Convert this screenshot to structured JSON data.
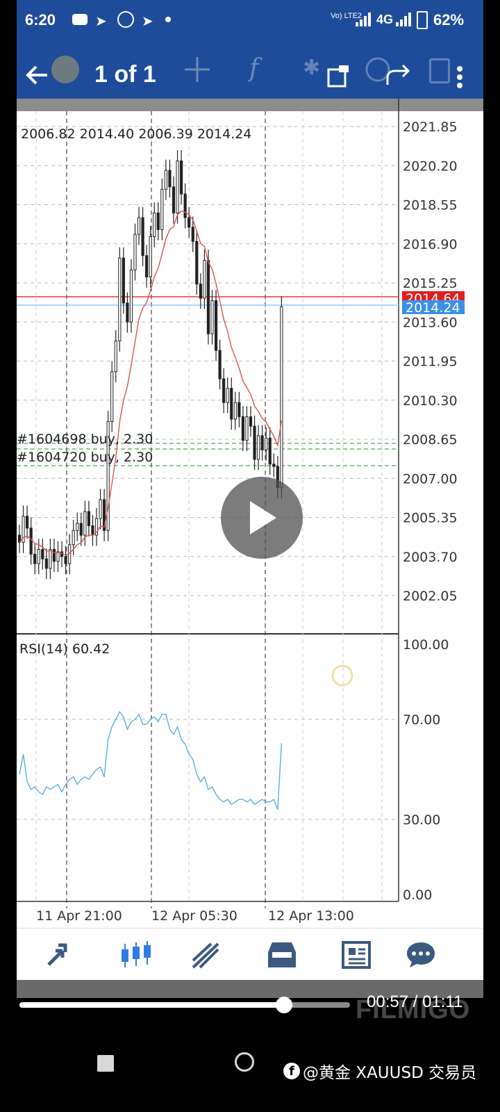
{
  "status_bar": {
    "time": "6:20",
    "network": "4G",
    "volte": "Vo) LTE2",
    "battery": "62%"
  },
  "toolbar": {
    "back_icon": "arrow-left-icon",
    "title": "1 of 1",
    "icons": [
      "crosshair-icon",
      "function-icon",
      "share-icon",
      "redo-icon",
      "more-vert-icon"
    ]
  },
  "chart": {
    "ohlc_text": "2006.82 2014.40 2006.39 2014.24",
    "price_levels": [
      "2021.85",
      "2020.20",
      "2018.55",
      "2016.90",
      "2015.25",
      "2013.60",
      "2011.95",
      "2010.30",
      "2008.65",
      "2007.00",
      "2005.35",
      "2003.70",
      "2002.05"
    ],
    "ask_price": "2014.64",
    "bid_price": "2014.24",
    "orders": [
      {
        "label": "#1604698 buy, 2.30"
      },
      {
        "label": "#1604720 buy, 2.30"
      }
    ],
    "rsi_label": "RSI(14) 60.42",
    "rsi_levels": [
      "100.00",
      "70.00",
      "30.00",
      "0.00"
    ],
    "time_labels": [
      "11 Apr 21:00",
      "12 Apr 05:30",
      "12 Apr 13:00"
    ],
    "colors": {
      "up": "#222222",
      "ma": "#d9534f",
      "ask_line": "#e53935",
      "bid_line": "#90caf9",
      "rsi": "#5aaee0",
      "ask_bg": "#e02020",
      "bid_bg": "#3b8fe8"
    }
  },
  "chart_data": {
    "type": "candlestick",
    "instrument": "XAUUSD",
    "ylim": [
      2001.0,
      2022.5
    ],
    "closes": [
      2004.3,
      2005.4,
      2004.9,
      2003.8,
      2003.4,
      2004.0,
      2003.6,
      2003.2,
      2004.0,
      2003.5,
      2003.9,
      2003.7,
      2003.4,
      2004.2,
      2004.8,
      2005.1,
      2004.6,
      2005.6,
      2005.0,
      2004.6,
      2005.3,
      2006.1,
      2004.8,
      2009.4,
      2011.5,
      2012.8,
      2016.3,
      2014.4,
      2013.6,
      2015.8,
      2017.3,
      2018.0,
      2016.4,
      2015.5,
      2017.2,
      2018.2,
      2017.5,
      2019.2,
      2020.0,
      2019.3,
      2018.2,
      2020.4,
      2019.0,
      2018.0,
      2017.6,
      2017.0,
      2015.2,
      2014.6,
      2016.2,
      2013.1,
      2014.5,
      2012.4,
      2011.2,
      2010.2,
      2010.8,
      2009.5,
      2010.2,
      2009.6,
      2008.6,
      2009.6,
      2009.2,
      2007.8,
      2008.8,
      2008.2,
      2008.7,
      2007.6,
      2007.5,
      2006.6,
      2014.24
    ],
    "rsi_values": [
      48,
      56,
      45,
      42,
      43,
      41,
      40,
      43,
      42,
      43,
      44,
      41,
      44,
      46,
      47,
      44,
      46,
      47,
      46,
      48,
      50,
      51,
      47,
      62,
      67,
      70,
      73,
      71,
      66,
      69,
      70,
      72,
      68,
      68,
      70,
      71,
      69,
      72,
      72,
      66,
      64,
      67,
      62,
      60,
      56,
      54,
      48,
      45,
      47,
      42,
      43,
      40,
      38,
      37,
      38,
      36,
      37,
      38,
      38,
      37,
      38,
      36,
      37,
      38,
      37,
      37,
      38,
      34,
      60.42
    ]
  },
  "bottom_nav": {
    "items": [
      "quotes-icon",
      "chart-icon",
      "trade-icon",
      "history-icon",
      "news-icon",
      "chat-icon"
    ]
  },
  "video": {
    "time": "00:57 / 01:11",
    "progress": 0.8,
    "watermark": "FILMIGO",
    "credit": "@黄金 XAUUSD 交易员"
  }
}
